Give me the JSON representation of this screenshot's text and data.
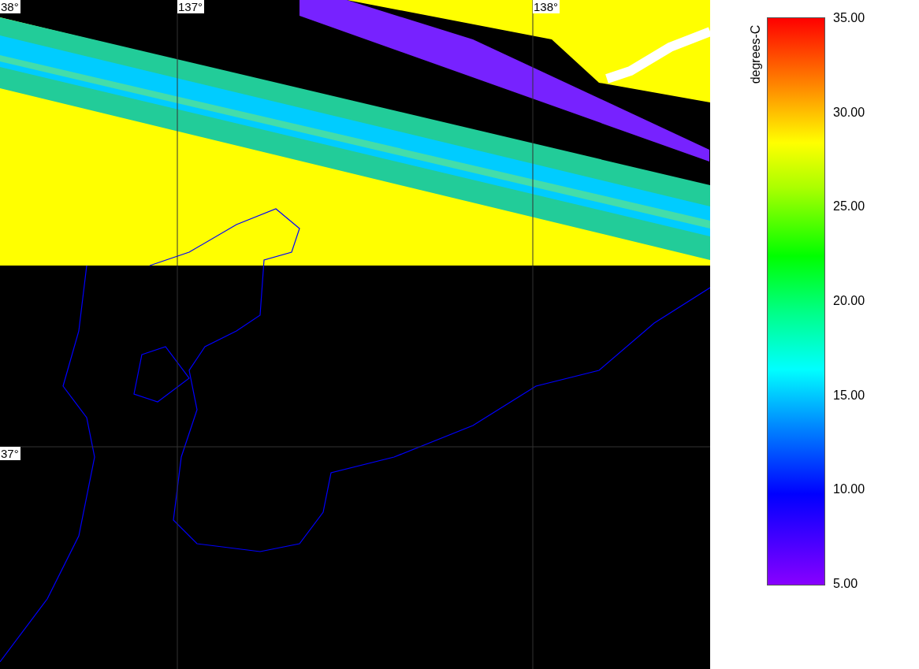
{
  "map": {
    "lat_labels": [
      "38°",
      "37°"
    ],
    "lon_labels": [
      "137°",
      "138°"
    ]
  },
  "colorbar": {
    "title": "degrees-C",
    "ticks": [
      "35.00",
      "30.00",
      "25.00",
      "20.00",
      "15.00",
      "10.00",
      "5.00"
    ]
  }
}
